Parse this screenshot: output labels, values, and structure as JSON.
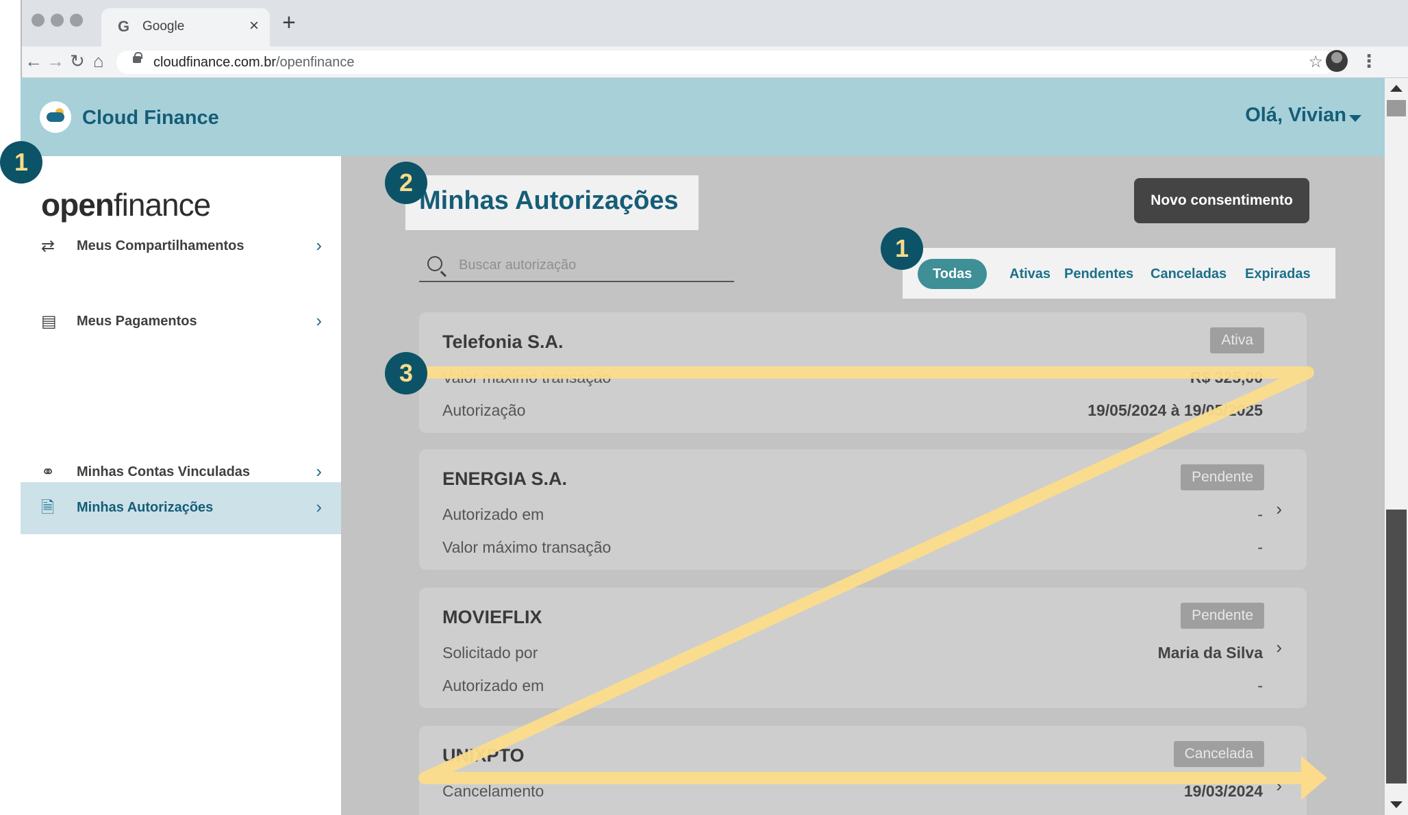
{
  "browser": {
    "tab_title": "Google",
    "tab_favicon": "G",
    "url_domain": "cloudfinance.com.br",
    "url_path": "/openfinance"
  },
  "header": {
    "brand": "Cloud Finance",
    "greeting": "Olá, Vivian"
  },
  "sidebar": {
    "logo_open": "open",
    "logo_finance": "finance",
    "items": [
      {
        "label": "Meus Compartilhamentos",
        "icon": "sync-icon"
      },
      {
        "label": "Meus Pagamentos",
        "icon": "payment-icon"
      },
      {
        "label": "Minhas Autorizações",
        "icon": "document-check-icon",
        "active": true
      },
      {
        "label": "Minhas Contas Vinculadas",
        "icon": "link-icon"
      }
    ]
  },
  "main": {
    "page_title": "Minhas Autorizações",
    "new_button": "Novo consentimento",
    "search_placeholder": "Buscar autorização",
    "filters": [
      "Todas",
      "Ativas",
      "Pendentes",
      "Canceladas",
      "Expiradas"
    ],
    "active_filter": "Todas",
    "cards": [
      {
        "name": "Telefonia S.A.",
        "status": "Ativa",
        "rows": [
          {
            "label": "Valor máximo transação",
            "value": "R$ 325,00"
          },
          {
            "label": "Autorização",
            "value": "19/05/2024 à 19/05/2025"
          }
        ]
      },
      {
        "name": "ENERGIA S.A.",
        "status": "Pendente",
        "rows": [
          {
            "label": "Autorizado em",
            "value": "-"
          },
          {
            "label": "Valor máximo transação",
            "value": "-"
          }
        ]
      },
      {
        "name": "MOVIEFLIX",
        "status": "Pendente",
        "rows": [
          {
            "label": "Solicitado por",
            "value": "Maria da Silva"
          },
          {
            "label": "Autorizado em",
            "value": "-"
          }
        ]
      },
      {
        "name": "UNIXPTO",
        "status": "Cancelada",
        "rows": [
          {
            "label": "Cancelamento",
            "value": "19/03/2024"
          }
        ]
      }
    ]
  },
  "annotations": {
    "markers": [
      "1",
      "2",
      "1",
      "3"
    ],
    "arrow_color": "#fcdc8a",
    "marker_color": "#0c5367"
  }
}
